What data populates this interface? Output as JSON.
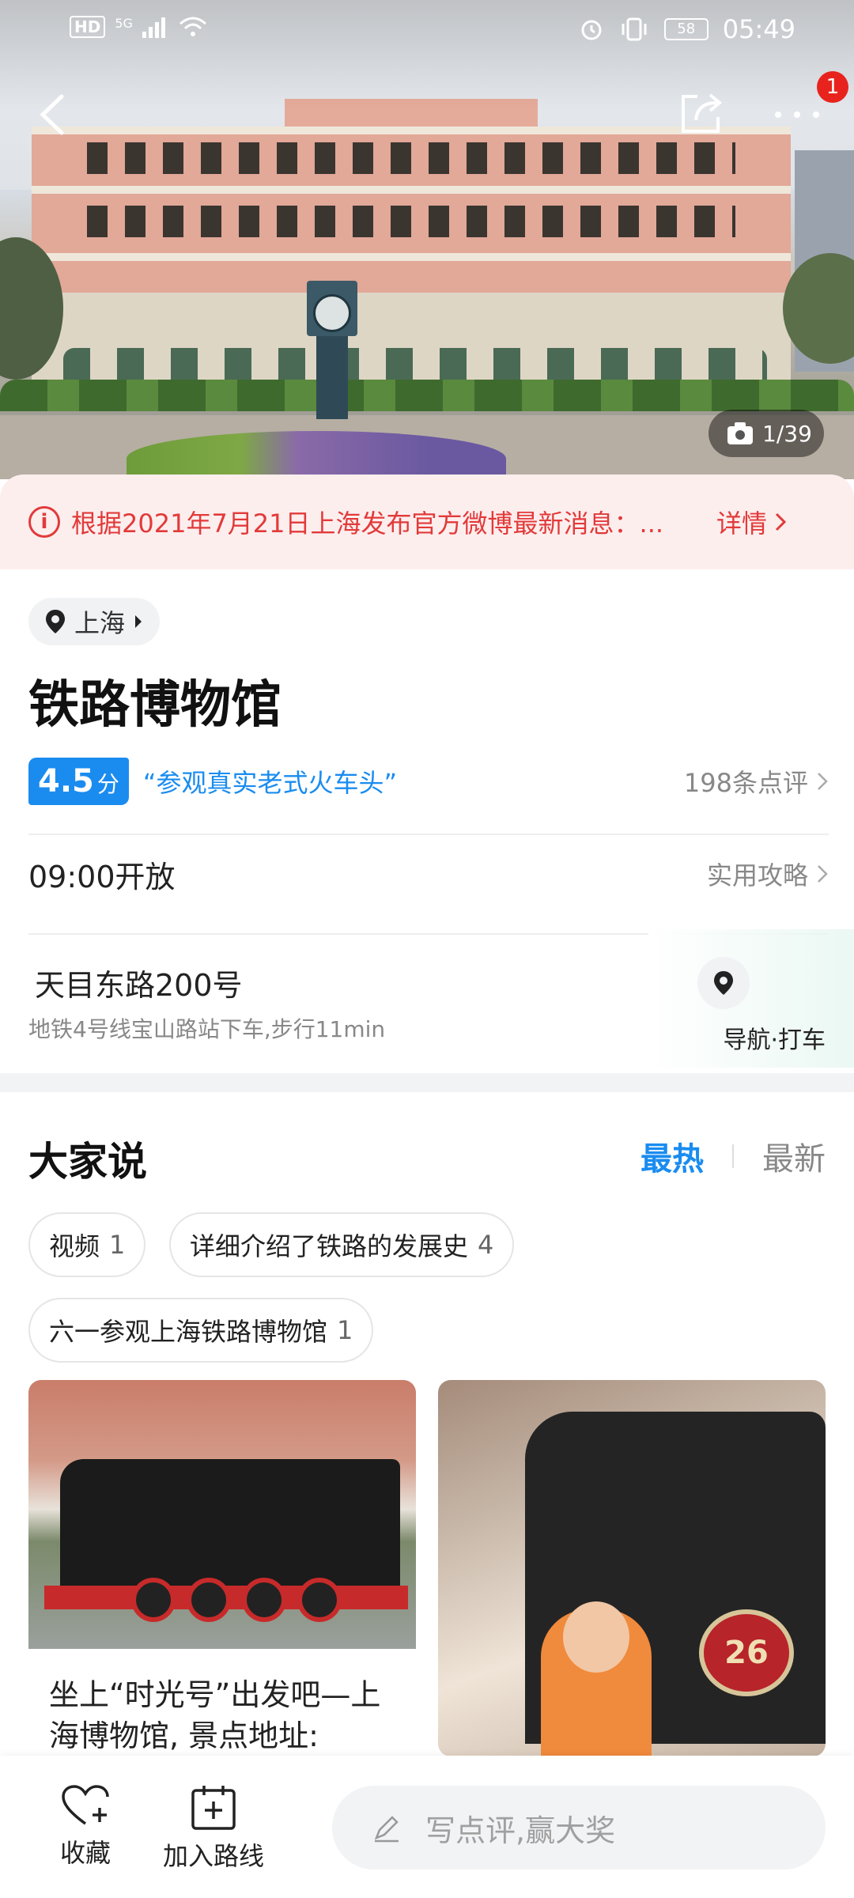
{
  "status_bar": {
    "left_badge": "HD",
    "signal": "5G",
    "battery": "58",
    "time": "05:49"
  },
  "header": {
    "back_icon": "chevron-left-icon",
    "share_icon": "share-icon",
    "more_icon": "more-dots-icon",
    "notification_count": "1",
    "photo_counter": "1/39"
  },
  "notice": {
    "text": "根据2021年7月21日上海发布官方微博最新消息：...",
    "detail_label": "详情",
    "color": "#e23a3a"
  },
  "poi": {
    "city": "上海",
    "name": "铁路博物馆",
    "score": "4.5",
    "score_unit": "分",
    "quote": "“参观真实老式火车头”",
    "review_count": "198条点评",
    "hours": "09:00开放",
    "guide_label": "实用攻略",
    "address": "天目东路200号",
    "transit": "地铁4号线宝山路站下车,步行11min",
    "nav_label": "导航·打车",
    "accent_color": "#1a8cf0"
  },
  "discussion": {
    "title": "大家说",
    "sort_hot": "最热",
    "sort_new": "最新",
    "tags": [
      {
        "label": "视频",
        "count": "1"
      },
      {
        "label": "详细介绍了铁路的发展史",
        "count": "4"
      },
      {
        "label": "六一参观上海铁路博物馆",
        "count": "1"
      }
    ],
    "cards": [
      {
        "caption": "坐上“时光号”出发吧—上海博物馆, 景点地址:"
      },
      {
        "plate": "26"
      }
    ]
  },
  "bottom_bar": {
    "favorite_label": "收藏",
    "route_label": "加入路线",
    "write_placeholder": "写点评,赢大奖"
  }
}
